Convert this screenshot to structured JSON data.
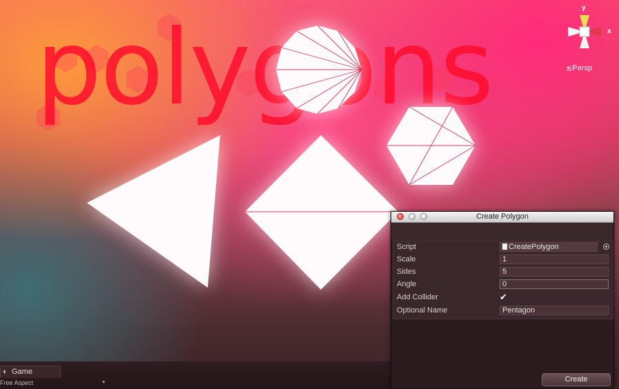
{
  "scene": {
    "title_text": "polygons",
    "gizmo": {
      "y_label": "y",
      "x_label": "x"
    },
    "persp_label": "Persp",
    "shapes": [
      "triangle",
      "square",
      "hexagon",
      "circle-polygon"
    ]
  },
  "game_tab": {
    "label": "Game",
    "icon": "pacman-icon",
    "aspect_label": "Free Aspect"
  },
  "dialog": {
    "title": "Create Polygon",
    "fields": {
      "script_label": "Script",
      "script_value": "CreatePolygon",
      "scale_label": "Scale",
      "scale_value": "1",
      "sides_label": "Sides",
      "sides_value": "5",
      "angle_label": "Angle",
      "angle_value": "0",
      "collider_label": "Add Collider",
      "collider_checked": true,
      "name_label": "Optional Name",
      "name_value": "Pentagon"
    },
    "create_label": "Create"
  },
  "colors": {
    "title_red": "#ff0a2a",
    "panel_bg": "#2b1b1e",
    "field_bg": "#4a3236"
  }
}
